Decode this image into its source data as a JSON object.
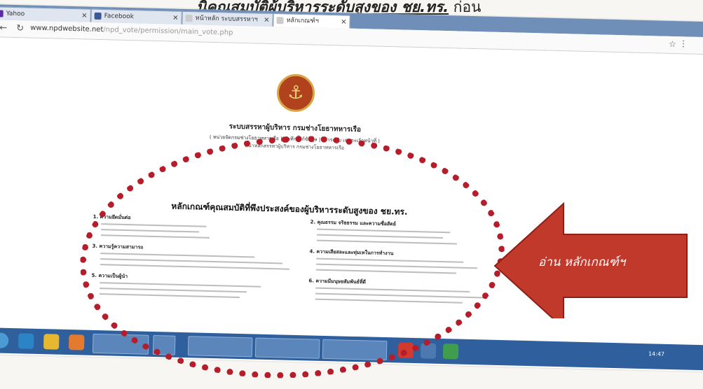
{
  "caption": {
    "prefix": "",
    "underlined": "นิคุณสมบัติผู้บริหารระดับสูงของ ชย.ทร.",
    "suffix": " ก่อน"
  },
  "browser": {
    "tabs": [
      {
        "label": "Yahoo",
        "favicon_color": "#5b2ca0",
        "active": false
      },
      {
        "label": "Facebook",
        "favicon_color": "#3b5998",
        "active": false
      },
      {
        "label": "หน้าหลัก ระบบสรรหาฯ",
        "favicon_color": "#cccccc",
        "active": false
      },
      {
        "label": "หลักเกณฑ์ฯ",
        "favicon_color": "#cccccc",
        "active": true
      }
    ],
    "url_main": "www.npdwebsite.net",
    "url_path": "/npd_vote/permission/main_vote.php"
  },
  "page": {
    "system_title": "ระบบสรรหาผู้บริหาร กรมช่างโยธาทหารเรือ",
    "system_subtitle1": "( หน่วยจัดกรมช่างโยธาทหารเรือ | บันทึกลิ้งก์ข้อมูล | เข้าระบบ เฉพาะเจ้าหน้าที่ )",
    "system_subtitle2": "หน้าหลักสรรหาผู้บริหาร กรมช่างโยธาทหารเรือ",
    "criteria_title": "หลักเกณฑ์คุณสมบัติที่พึงประสงค์ของผู้บริหารระดับสูงของ ชย.ทร.",
    "sections_left": [
      "1. ความยึดมั่นต่อ",
      "3. ความรู้ความสามารถ",
      "5. ความเป็นผู้นำ"
    ],
    "sections_right": [
      "2. คุณธรรม จริยธรรม และความซื่อสัตย์",
      "4. ความเสียสละและทุ่มเทในการทำงาน",
      "6. ความมีมนุษยสัมพันธ์ที่ดี"
    ]
  },
  "annotation": {
    "arrow_text": "อ่าน หลักเกณฑ์ฯ",
    "circle_color": "#b51d2a",
    "arrow_color": "#c0392b"
  },
  "taskbar": {
    "time": "14:47"
  }
}
